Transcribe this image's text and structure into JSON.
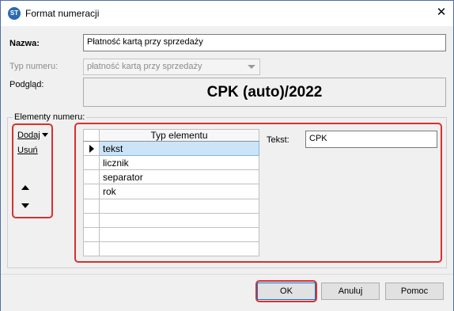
{
  "window": {
    "title": "Format numeracji",
    "icon": "app-logo-icon",
    "close_glyph": "✕"
  },
  "form": {
    "name_label": "Nazwa:",
    "name_value": "Płatność kartą przy sprzedaży",
    "type_label": "Typ numeru:",
    "type_value": "płatność kartą przy sprzedaży",
    "preview_label": "Podgląd:",
    "preview_value": "CPK (auto)/2022"
  },
  "elements_group": {
    "legend": "Elementy numeru:",
    "add_label": "Dodaj",
    "remove_label": "Usuń",
    "grid": {
      "column_header": "Typ elementu",
      "rows": [
        "tekst",
        "licznik",
        "separator",
        "rok",
        "",
        "",
        "",
        ""
      ],
      "selected_index": 0
    },
    "text_label": "Tekst:",
    "text_value": "CPK"
  },
  "buttons": {
    "ok": "OK",
    "cancel": "Anuluj",
    "help": "Pomoc"
  },
  "colors": {
    "highlight_border": "#d93030",
    "selection": "#cce4f7",
    "default_button_border": "#0078d7"
  }
}
